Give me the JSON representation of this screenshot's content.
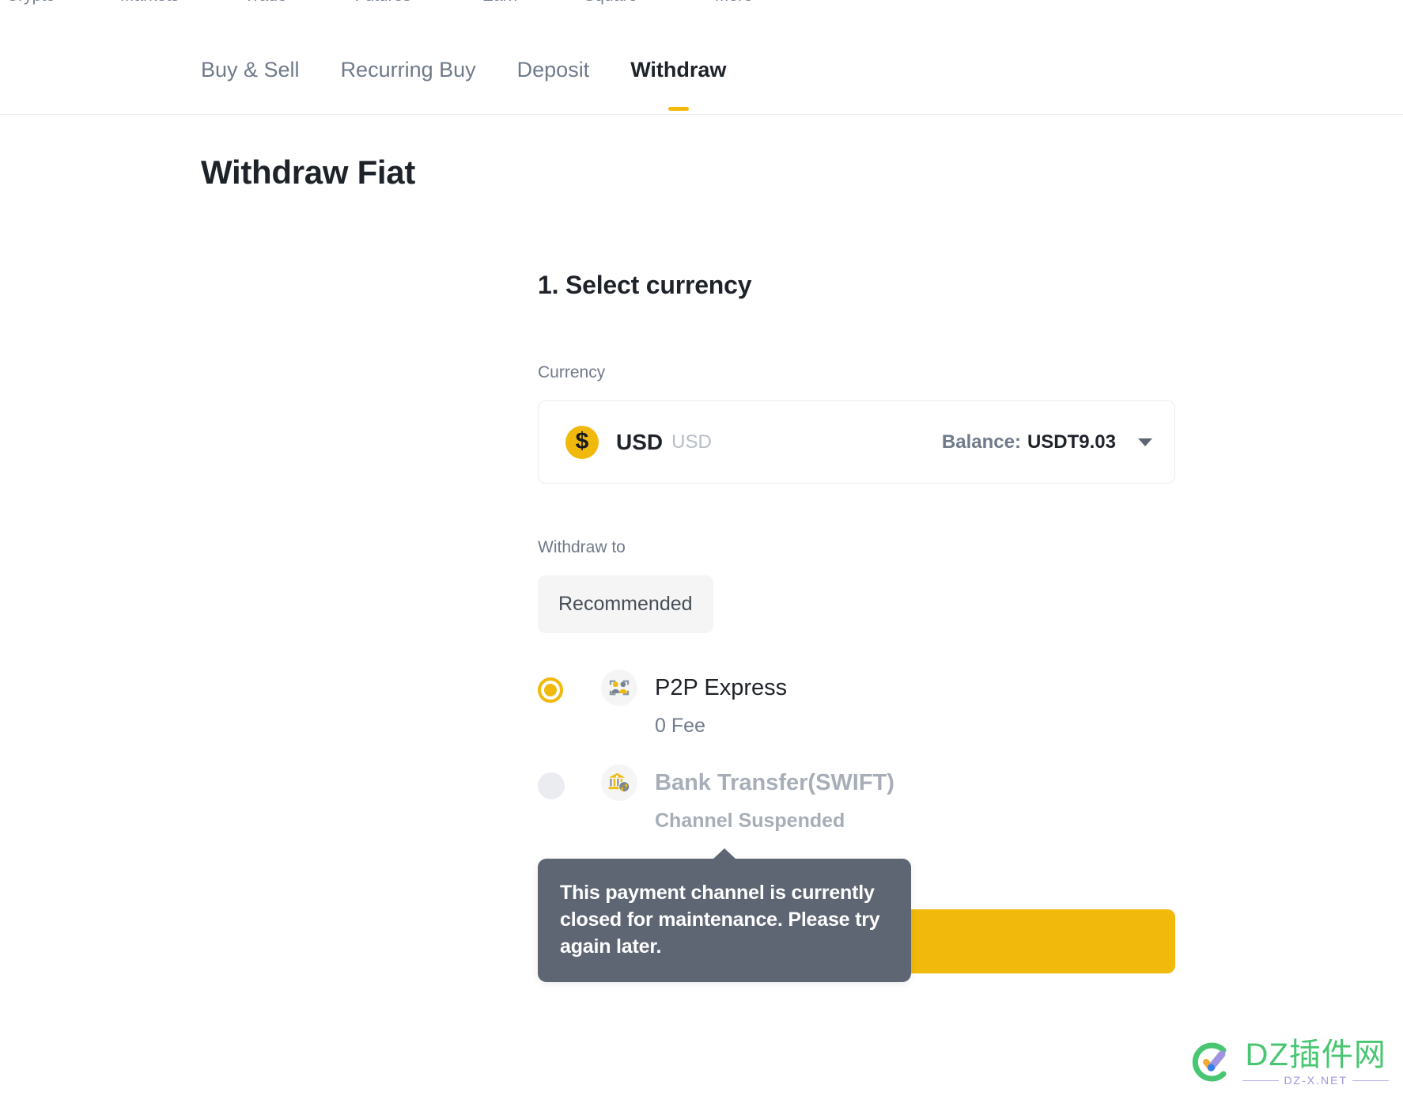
{
  "global_nav": {
    "items": [
      {
        "label": "Crypto"
      },
      {
        "label": "Markets"
      },
      {
        "label": "Trade"
      },
      {
        "label": "Futures"
      },
      {
        "label": "Earn"
      },
      {
        "label": "Square"
      },
      {
        "label": "More"
      }
    ]
  },
  "tabs": [
    {
      "label": "Buy & Sell",
      "active": false
    },
    {
      "label": "Recurring Buy",
      "active": false
    },
    {
      "label": "Deposit",
      "active": false
    },
    {
      "label": "Withdraw",
      "active": true
    }
  ],
  "page": {
    "title": "Withdraw Fiat"
  },
  "step": {
    "title": "1. Select currency"
  },
  "currency": {
    "label": "Currency",
    "icon_symbol": "$",
    "code": "USD",
    "name": "USD",
    "balance_label": "Balance:",
    "balance_value": "USDT9.03"
  },
  "withdraw_to": {
    "label": "Withdraw to",
    "pill_label": "Recommended"
  },
  "channels": [
    {
      "name": "P2P Express",
      "sub": "0 Fee",
      "selected": true,
      "disabled": false,
      "icon": "p2p-people-icon"
    },
    {
      "name": "Bank Transfer(SWIFT)",
      "sub": "Channel Suspended",
      "selected": false,
      "disabled": true,
      "icon": "bank-transfer-icon"
    }
  ],
  "tooltip": {
    "text": "This payment channel is currently closed for maintenance. Please try again later."
  },
  "continue_button": {
    "label": ""
  },
  "watermark": {
    "main": "DZ插件网",
    "sub": "DZ-X.NET"
  },
  "colors": {
    "accent_yellow": "#f0b90b",
    "button_yellow": "#f5d132",
    "text_primary": "#1e2329",
    "text_secondary": "#707a8a",
    "text_disabled": "#a7aeb8",
    "tooltip_bg": "#5e6673",
    "border": "#eaecef",
    "pill_bg": "#f5f5f5",
    "watermark_green": "#3fc46a"
  }
}
